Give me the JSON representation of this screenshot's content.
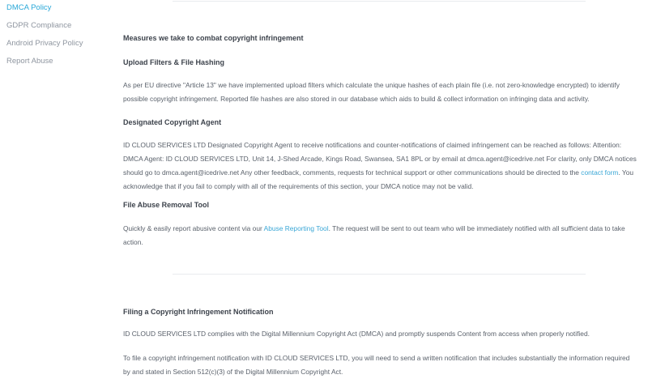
{
  "sidebar": {
    "items": [
      {
        "label": "DMCA Policy",
        "active": true
      },
      {
        "label": "GDPR Compliance",
        "active": false
      },
      {
        "label": "Android Privacy Policy",
        "active": false
      },
      {
        "label": "Report Abuse",
        "active": false
      }
    ]
  },
  "content": {
    "measures_heading": "Measures we take to combat copyright infringement",
    "upload_heading": "Upload Filters & File Hashing",
    "upload_text": "As per EU directive \"Article 13\" we have implemented upload filters which calculate the unique hashes of each plain file (i.e. not zero-knowledge encrypted) to identify possible copyright infringement. Reported file hashes are also stored in our database which aids to build & collect information on infringing data and activity.",
    "agent_heading": "Designated Copyright Agent",
    "agent_text_1": "ID CLOUD SERVICES LTD Designated Copyright Agent to receive notifications and counter-notifications of claimed infringement can be reached as follows: Attention: DMCA Agent: ID CLOUD SERVICES LTD, Unit 14, J-Shed Arcade, Kings Road, Swansea, SA1 8PL or by email at dmca.agent@icedrive.net For clarity, only DMCA notices should go to dmca.agent@icedrive.net Any other feedback, comments, requests for technical support or other communications should be directed to the ",
    "agent_link": "contact form",
    "agent_text_2": ". You acknowledge that if you fail to comply with all of the requirements of this section, your DMCA notice may not be valid.",
    "abuse_heading": "File Abuse Removal Tool",
    "abuse_text_1": "Quickly & easily report abusive content via our ",
    "abuse_link": "Abuse Reporting Tool",
    "abuse_text_2": ". The request will be sent to out team who will be immediately notified with all sufficient data to take action.",
    "filing_heading": "Filing a Copyright Infringement Notification",
    "filing_text_1": "ID CLOUD SERVICES LTD complies with the Digital Millennium Copyright Act (DMCA) and promptly suspends Content from access when properly notified.",
    "filing_text_2": "To file a copyright infringement notification with ID CLOUD SERVICES LTD, you will need to send a written notification that includes substantially the information required by and stated in Section 512(c)(3) of the Digital Millennium Copyright Act."
  }
}
